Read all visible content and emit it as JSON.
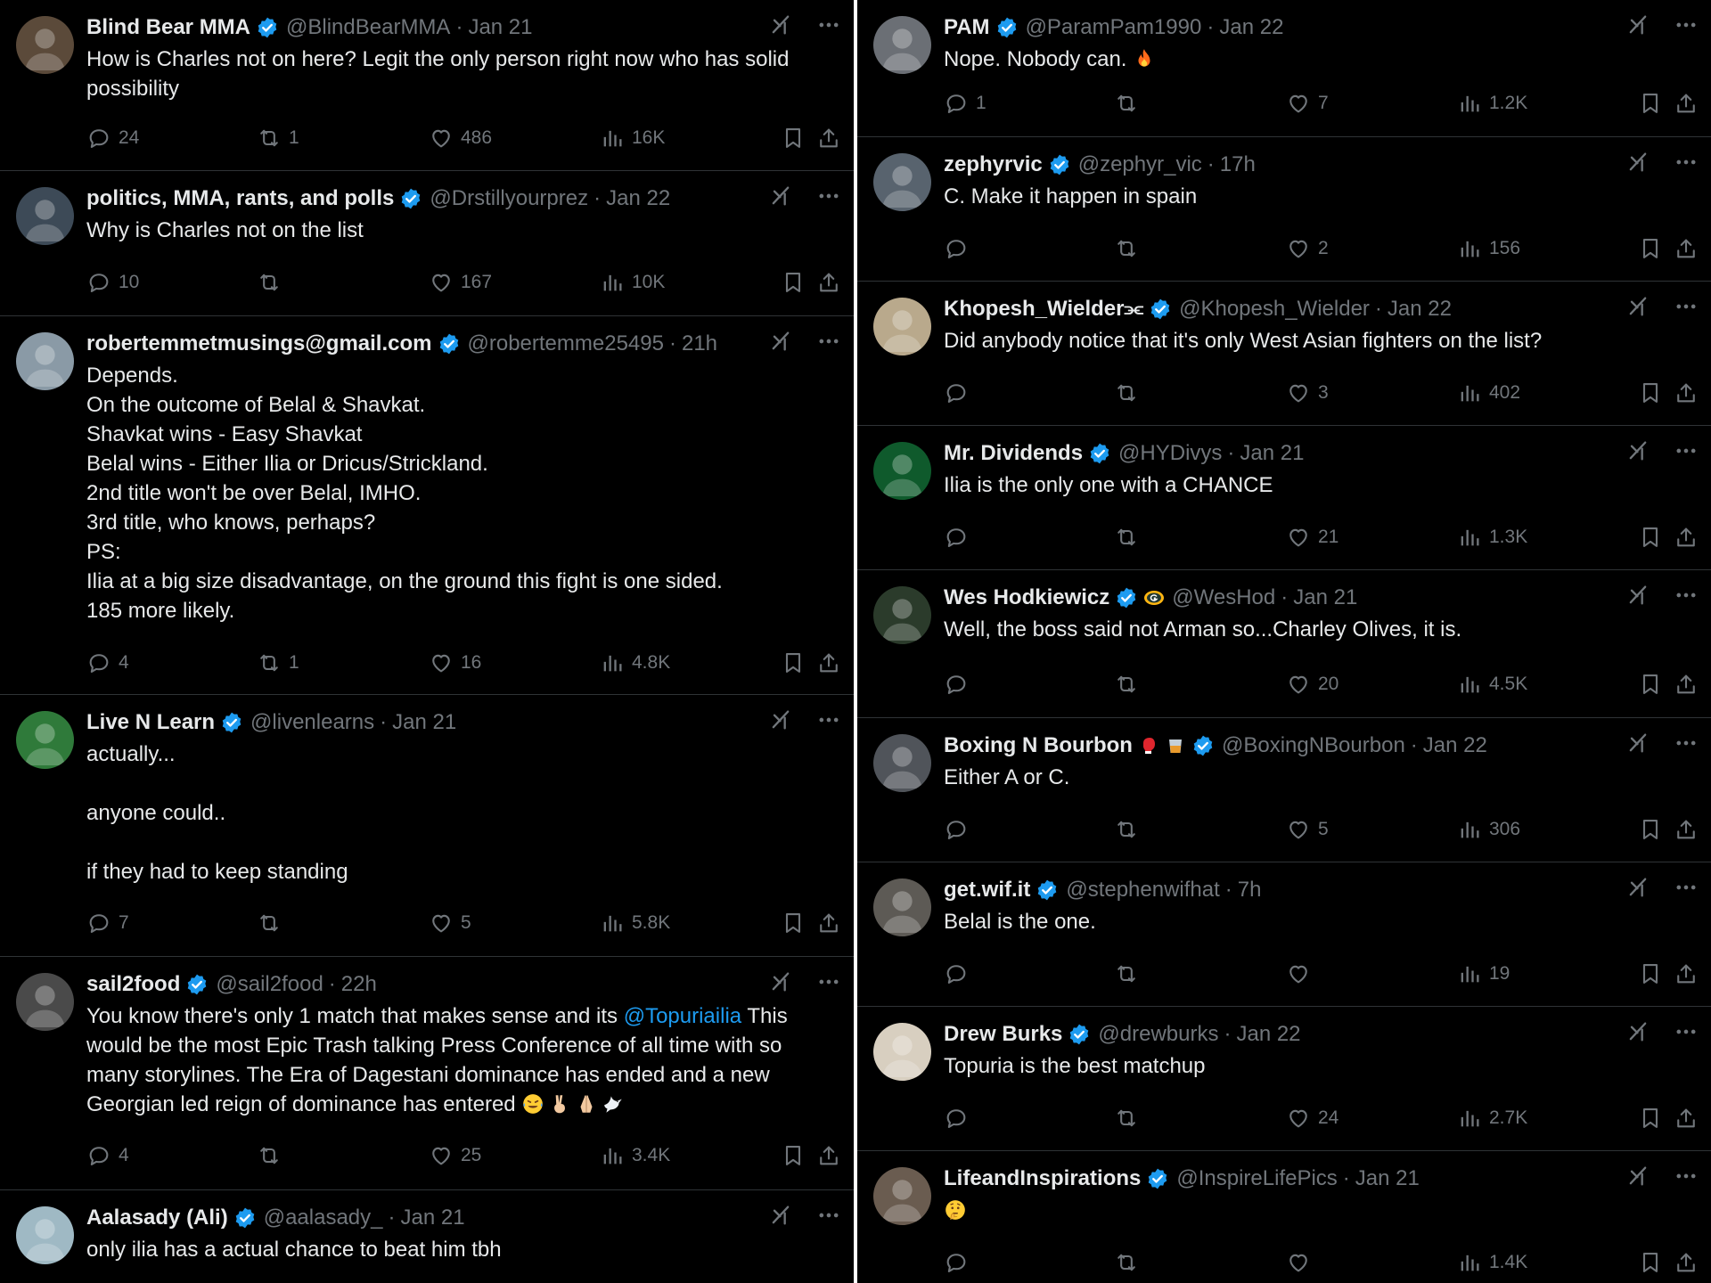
{
  "left_column": [
    {
      "name": "Blind Bear MMA",
      "handle": "@BlindBearMMA",
      "time": "Jan 21",
      "lines": [
        "How is Charles not on here? Legit the only person right now who has solid",
        "possibility"
      ],
      "reply_count": "24",
      "repost_count": "1",
      "like_count": "486",
      "view_count": "16K",
      "avatar_color": "#5b4a3a"
    },
    {
      "name": "politics, MMA, rants, and polls",
      "handle": "@Drstillyourprez",
      "time": "Jan 22",
      "lines": [
        "Why is Charles not on the list"
      ],
      "reply_count": "10",
      "repost_count": "",
      "like_count": "167",
      "view_count": "10K",
      "avatar_color": "#3d4a57"
    },
    {
      "name": "robertemmetmusings@gmail.com",
      "handle": "@robertemme25495",
      "time": "21h",
      "lines": [
        "Depends.",
        "On the outcome of Belal & Shavkat.",
        "Shavkat wins - Easy Shavkat",
        "Belal wins - Either Ilia or Dricus/Strickland.",
        "2nd title won't be over Belal, IMHO.",
        "3rd title, who knows, perhaps?",
        "PS:",
        "Ilia at a big size disadvantage, on the ground this fight is one sided.",
        "185 more likely."
      ],
      "reply_count": "4",
      "repost_count": "1",
      "like_count": "16",
      "view_count": "4.8K",
      "avatar_color": "#8a9aa6"
    },
    {
      "name": "Live N Learn",
      "handle": "@livenlearns",
      "time": "Jan 21",
      "lines": [
        "actually...",
        "",
        "anyone could..",
        "",
        "if they had to keep standing"
      ],
      "reply_count": "7",
      "repost_count": "",
      "like_count": "5",
      "view_count": "5.8K",
      "avatar_color": "#2f7a3a"
    },
    {
      "name": "sail2food",
      "handle": "@sail2food",
      "time": "22h",
      "lines": [
        "You know there's only 1 match that makes sense and its @Topuriailia This",
        "would be the most Epic Trash talking Press Conference of all time with so",
        "many storylines. The Era of Dagestani dominance has ended and a new",
        "Georgian led reign of dominance has entered"
      ],
      "mention": "@Topuriailia",
      "trailing_emojis": [
        "laughing-tears-emoji",
        "victory-hand-emoji",
        "folded-hands-emoji",
        "dove-emoji"
      ],
      "reply_count": "4",
      "repost_count": "",
      "like_count": "25",
      "view_count": "3.4K",
      "avatar_color": "#4a4a4a"
    },
    {
      "name": "Aalasady (Ali)",
      "handle": "@aalasady_",
      "time": "Jan 21",
      "lines": [
        "only ilia has a actual chance to beat him tbh"
      ],
      "reply_count": "",
      "repost_count": "",
      "like_count": "",
      "view_count": "",
      "avatar_color": "#9fb9c4"
    }
  ],
  "right_column": [
    {
      "name": "PAM",
      "handle": "@ParamPam1990",
      "time": "Jan 22",
      "lines": [
        "Nope. Nobody can."
      ],
      "trailing_emojis": [
        "fire-emoji"
      ],
      "reply_count": "1",
      "repost_count": "",
      "like_count": "7",
      "view_count": "1.2K",
      "avatar_color": "#6b6f75"
    },
    {
      "name": "zephyrvic",
      "handle": "@zephyr_vic",
      "time": "17h",
      "lines": [
        "C. Make it happen in spain"
      ],
      "reply_count": "",
      "repost_count": "",
      "like_count": "2",
      "view_count": "156",
      "avatar_color": "#58636e"
    },
    {
      "name": "Khopesh_Wielder⫘",
      "handle": "@Khopesh_Wielder",
      "time": "Jan 22",
      "lines": [
        "Did anybody notice that it's only West Asian fighters on the list?"
      ],
      "reply_count": "",
      "repost_count": "",
      "like_count": "3",
      "view_count": "402",
      "avatar_color": "#b9a98c"
    },
    {
      "name": "Mr. Dividends",
      "handle": "@HYDivys",
      "time": "Jan 21",
      "lines": [
        "Ilia is the only one with a CHANCE"
      ],
      "reply_count": "",
      "repost_count": "",
      "like_count": "21",
      "view_count": "1.3K",
      "avatar_color": "#0f5a2c"
    },
    {
      "name": "Wes Hodkiewicz",
      "handle": "@WesHod",
      "time": "Jan 21",
      "badge_emoji": "packers-logo",
      "lines": [
        "Well, the boss said not Arman so...Charley Olives, it is."
      ],
      "reply_count": "",
      "repost_count": "",
      "like_count": "20",
      "view_count": "4.5K",
      "avatar_color": "#2b3b2b"
    },
    {
      "name": "Boxing N Bourbon",
      "handle": "@BoxingNBourbon",
      "time": "Jan 22",
      "name_emojis": [
        "boxing-glove-emoji",
        "tumbler-glass-emoji"
      ],
      "lines": [
        "Either A or C."
      ],
      "reply_count": "",
      "repost_count": "",
      "like_count": "5",
      "view_count": "306",
      "avatar_color": "#50545a"
    },
    {
      "name": "get.wif.it",
      "handle": "@stephenwifhat",
      "time": "7h",
      "lines": [
        "Belal is the one."
      ],
      "reply_count": "",
      "repost_count": "",
      "like_count": "",
      "view_count": "19",
      "avatar_color": "#5d5a55"
    },
    {
      "name": "Drew Burks",
      "handle": "@drewburks",
      "time": "Jan 22",
      "lines": [
        "Topuria is the best matchup"
      ],
      "reply_count": "",
      "repost_count": "",
      "like_count": "24",
      "view_count": "2.7K",
      "avatar_color": "#d8cfc0"
    },
    {
      "name": "LifeandInspirations",
      "handle": "@InspireLifePics",
      "time": "Jan 21",
      "lines": [],
      "trailing_emojis": [
        "thinking-face-emoji"
      ],
      "reply_count": "",
      "repost_count": "",
      "like_count": "",
      "view_count": "1.4K",
      "avatar_color": "#6a5c50"
    }
  ],
  "colors": {
    "text": "#e7e9ea",
    "muted": "#71767b",
    "accent": "#1d9bf0",
    "divider": "#2f3336",
    "background": "#000000"
  }
}
